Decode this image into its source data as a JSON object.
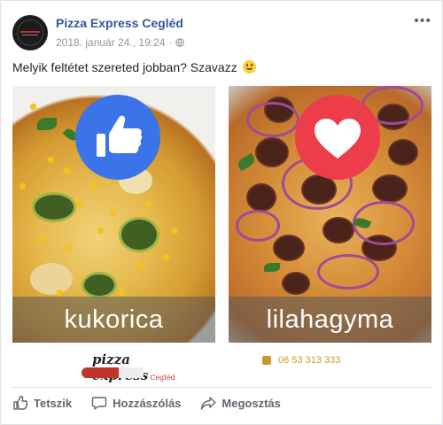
{
  "post": {
    "page_name": "Pizza Express Cegléd",
    "timestamp": "2018. január 24., 19:24",
    "audience_icon": "globe-icon",
    "more_label": "•••",
    "text": "Melyik feltétet szereted jobban? Szavazz",
    "emoji": "smile-emoji"
  },
  "images": {
    "left": {
      "reaction_icon": "like-icon",
      "label": "kukorica",
      "brand": "pizza express",
      "brand_suffix": "Cegléd"
    },
    "right": {
      "reaction_icon": "love-icon",
      "label": "lilahagyma",
      "phone": "06 53 313 333"
    }
  },
  "actions": {
    "like": "Tetszik",
    "comment": "Hozzászólás",
    "share": "Megosztás"
  },
  "colors": {
    "page_name": "#365899",
    "like_blue": "#3b74e8",
    "love_red": "#ee3d4a",
    "meta_gray": "#90949c"
  }
}
